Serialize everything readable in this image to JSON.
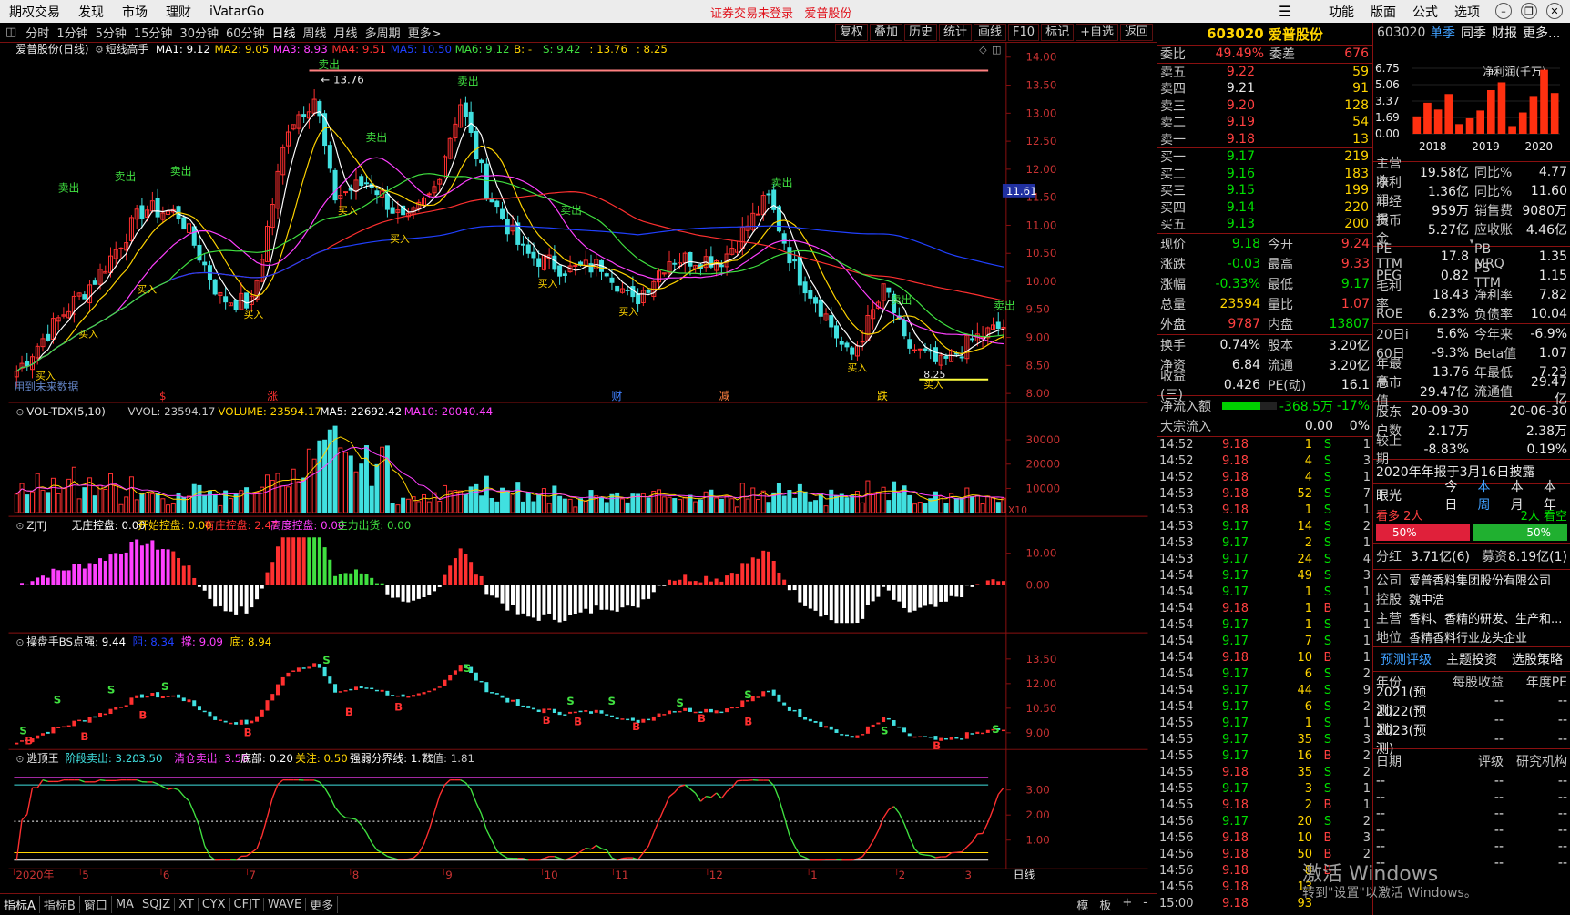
{
  "menu": [
    "期权交易",
    "发现",
    "市场",
    "理财",
    "iVatarGo"
  ],
  "notice": [
    "证券交易未登录",
    "爱普股份"
  ],
  "right_menu": [
    "功能",
    "版面",
    "公式",
    "选项"
  ],
  "timeframes": [
    "分时",
    "1分钟",
    "5分钟",
    "15分钟",
    "30分钟",
    "60分钟",
    "日线",
    "周线",
    "月线",
    "多周期",
    "更多>"
  ],
  "toolbar_right": [
    "复权",
    "叠加",
    "历史",
    "统计",
    "画线",
    "F10",
    "标记",
    "+自选",
    "返回"
  ],
  "main": {
    "title": "爱普股份(日线)",
    "indicator": "短线高手",
    "ma": [
      {
        "label": "MA1: 9.12",
        "color": "#ffffff"
      },
      {
        "label": "MA2: 9.05",
        "color": "#ffd400"
      },
      {
        "label": "MA3: 8.93",
        "color": "#ff40ff"
      },
      {
        "label": "MA4: 9.51",
        "color": "#ff3030"
      },
      {
        "label": "MA5: 10.50",
        "color": "#2040ff"
      },
      {
        "label": "MA6: 9.12",
        "color": "#40e040"
      },
      {
        "label": "B: -",
        "color": "#ffd400"
      },
      {
        "label": "S: 9.42",
        "color": "#40e040"
      },
      {
        "label": ": 13.76",
        "color": "#ffd400"
      },
      {
        "label": ": 8.25",
        "color": "#ffd400"
      }
    ],
    "yticks": [
      "14.00",
      "13.50",
      "13.00",
      "12.50",
      "12.00",
      "11.50",
      "11.00",
      "10.50",
      "10.00",
      "9.50",
      "9.00",
      "8.50",
      "8.00"
    ],
    "high_label": "13.76",
    "low_label": "8.25",
    "price_tag": "11.61",
    "note": "用到未来数据",
    "sell_label": "卖出",
    "buy_label": "买入",
    "events": [
      "$",
      "涨",
      "财",
      "减",
      "跌"
    ]
  },
  "vol": {
    "title": "VOL-TDX(5,10)",
    "items": [
      {
        "label": "VVOL: 23594.17",
        "color": "#c8c8c8"
      },
      {
        "label": "VOLUME: 23594.17",
        "color": "#ffd400"
      },
      {
        "label": "MA5: 22692.42",
        "color": "#ffffff"
      },
      {
        "label": "MA10: 20040.44",
        "color": "#ff40ff"
      }
    ],
    "yticks": [
      "30000",
      "20000",
      "10000"
    ],
    "unit": "X10"
  },
  "zjtj": {
    "title": "ZJTJ",
    "items": [
      {
        "label": "无庄控盘: 0.00",
        "color": "#ffffff"
      },
      {
        "label": "开始控盘: 0.00",
        "color": "#ffd400"
      },
      {
        "label": "有庄控盘: 2.47",
        "color": "#ff3030"
      },
      {
        "label": "高度控盘: 0.00",
        "color": "#ff40ff"
      },
      {
        "label": "主力出货: 0.00",
        "color": "#40e040"
      }
    ],
    "yticks": [
      "10.00",
      "0.00"
    ]
  },
  "bs": {
    "title": "操盘手BS点",
    "items": [
      {
        "label": "强: 9.44",
        "color": "#ffffff"
      },
      {
        "label": "阻: 8.34",
        "color": "#2040ff"
      },
      {
        "label": "撑: 9.09",
        "color": "#ff40ff"
      },
      {
        "label": "底: 8.94",
        "color": "#ffd400"
      }
    ],
    "yticks": [
      "13.50",
      "12.00",
      "10.50",
      "9.00"
    ]
  },
  "tdw": {
    "title": "逃顶王",
    "items": [
      {
        "label": "阶段卖出: 3.20",
        "color": "#40e0e0"
      },
      {
        "label": ": 3.50",
        "color": "#40e0e0"
      },
      {
        "label": "清仓卖出: 3.50",
        "color": "#ff40ff"
      },
      {
        "label": "底部: 0.20",
        "color": "#ffffff"
      },
      {
        "label": "关注: 0.50",
        "color": "#ffd400"
      },
      {
        "label": "强弱分界线: 1.75",
        "color": "#ffffff"
      },
      {
        "label": "数值: 1.81",
        "color": "#c8c8c8"
      }
    ],
    "yticks": [
      "3.00",
      "2.00",
      "1.00"
    ]
  },
  "xaxis": {
    "labels": [
      "2020年",
      "5",
      "6",
      "7",
      "8",
      "9",
      "10",
      "11",
      "12",
      "1",
      "2",
      "3"
    ],
    "mode": "日线"
  },
  "bottom_tabs": [
    "指标A",
    "指标B",
    "窗口",
    "MA",
    "SQJZ",
    "XT",
    "CYX",
    "CFJT",
    "WAVE",
    "更多"
  ],
  "bottom_right": [
    "模",
    "板",
    "+",
    "-"
  ],
  "quote": {
    "code": "603020",
    "name": "爱普股份",
    "weibi": {
      "k": "委比",
      "v": "49.49%",
      "k2": "委差",
      "v2": "676"
    },
    "asks": [
      {
        "label": "卖五",
        "price": "9.22",
        "vol": "59"
      },
      {
        "label": "卖四",
        "price": "9.21",
        "vol": "91"
      },
      {
        "label": "卖三",
        "price": "9.20",
        "vol": "128"
      },
      {
        "label": "卖二",
        "price": "9.19",
        "vol": "54"
      },
      {
        "label": "卖一",
        "price": "9.18",
        "vol": "13"
      }
    ],
    "bids": [
      {
        "label": "买一",
        "price": "9.17",
        "vol": "219"
      },
      {
        "label": "买二",
        "price": "9.16",
        "vol": "183"
      },
      {
        "label": "买三",
        "price": "9.15",
        "vol": "199"
      },
      {
        "label": "买四",
        "price": "9.14",
        "vol": "220"
      },
      {
        "label": "买五",
        "price": "9.13",
        "vol": "200"
      }
    ],
    "stats": [
      {
        "k": "现价",
        "v": "9.18",
        "vc": "dn",
        "k2": "今开",
        "v2": "9.24",
        "v2c": "up"
      },
      {
        "k": "涨跌",
        "v": "-0.03",
        "vc": "dn",
        "k2": "最高",
        "v2": "9.33",
        "v2c": "up"
      },
      {
        "k": "涨幅",
        "v": "-0.33%",
        "vc": "dn",
        "k2": "最低",
        "v2": "9.17",
        "v2c": "dn"
      },
      {
        "k": "总量",
        "v": "23594",
        "vc": "yl",
        "k2": "量比",
        "v2": "1.07",
        "v2c": "up"
      },
      {
        "k": "外盘",
        "v": "9787",
        "vc": "up",
        "k2": "内盘",
        "v2": "13807",
        "v2c": "dn"
      }
    ],
    "stats2": [
      {
        "k": "换手",
        "v": "0.74%",
        "k2": "股本",
        "v2": "3.20亿"
      },
      {
        "k": "净资",
        "v": "6.84",
        "k2": "流通",
        "v2": "3.20亿"
      },
      {
        "k": "收益(三)",
        "v": "0.426",
        "k2": "PE(动)",
        "v2": "16.1"
      }
    ],
    "flow": [
      {
        "k": "净流入额",
        "bar": 0.7,
        "v": "-368.5万",
        "v2": "-17%"
      },
      {
        "k": "大宗流入",
        "v": "0.00",
        "v2": "0%"
      }
    ],
    "ticks": [
      [
        "14:52",
        "9.18",
        "1",
        "S",
        "1"
      ],
      [
        "14:52",
        "9.18",
        "4",
        "S",
        "3"
      ],
      [
        "14:52",
        "9.18",
        "4",
        "S",
        "1"
      ],
      [
        "14:53",
        "9.18",
        "52",
        "S",
        "7"
      ],
      [
        "14:53",
        "9.18",
        "1",
        "S",
        "1"
      ],
      [
        "14:53",
        "9.17",
        "14",
        "S",
        "2"
      ],
      [
        "14:53",
        "9.17",
        "2",
        "S",
        "1"
      ],
      [
        "14:53",
        "9.17",
        "24",
        "S",
        "4"
      ],
      [
        "14:54",
        "9.17",
        "49",
        "S",
        "3"
      ],
      [
        "14:54",
        "9.17",
        "1",
        "S",
        "1"
      ],
      [
        "14:54",
        "9.18",
        "1",
        "B",
        "1"
      ],
      [
        "14:54",
        "9.17",
        "1",
        "S",
        "1"
      ],
      [
        "14:54",
        "9.17",
        "7",
        "S",
        "1"
      ],
      [
        "14:54",
        "9.18",
        "10",
        "B",
        "1"
      ],
      [
        "14:54",
        "9.17",
        "6",
        "S",
        "2"
      ],
      [
        "14:54",
        "9.17",
        "44",
        "S",
        "9"
      ],
      [
        "14:54",
        "9.17",
        "6",
        "S",
        "2"
      ],
      [
        "14:55",
        "9.17",
        "1",
        "S",
        "1"
      ],
      [
        "14:55",
        "9.17",
        "35",
        "S",
        "3"
      ],
      [
        "14:55",
        "9.17",
        "16",
        "B",
        "2"
      ],
      [
        "14:55",
        "9.18",
        "35",
        "S",
        "2"
      ],
      [
        "14:55",
        "9.17",
        "3",
        "S",
        "1"
      ],
      [
        "14:55",
        "9.18",
        "2",
        "B",
        "1"
      ],
      [
        "14:56",
        "9.17",
        "20",
        "S",
        "2"
      ],
      [
        "14:56",
        "9.18",
        "10",
        "B",
        "3"
      ],
      [
        "14:56",
        "9.18",
        "50",
        "B",
        "2"
      ],
      [
        "14:56",
        "9.18",
        "8",
        "B",
        ""
      ],
      [
        "14:56",
        "9.18",
        "13",
        "",
        ""
      ],
      [
        "15:00",
        "9.18",
        "93",
        "",
        ""
      ]
    ]
  },
  "info": {
    "code": "603020",
    "tabs": [
      "单季",
      "同季",
      "财报",
      "更多..."
    ],
    "chart_title": "净利润(千万)",
    "chart_data": {
      "type": "bar",
      "yticks": [
        "6.75",
        "5.06",
        "3.37",
        "1.69",
        "0.00"
      ],
      "years": [
        "2018",
        "2019",
        "2020"
      ],
      "values": [
        1.8,
        3.2,
        2.5,
        4.1,
        1.0,
        1.6,
        2.4,
        4.5,
        5.3,
        0.8,
        2.2,
        3.9,
        6.6,
        4.2
      ],
      "ylim": [
        0,
        6.75
      ]
    },
    "fin": [
      {
        "k": "主营收",
        "v": "19.58亿",
        "k2": "同比%",
        "v2": "4.77"
      },
      {
        "k": "净利润",
        "v": "1.36亿",
        "k2": "同比%",
        "v2": "11.60"
      },
      {
        "k": "非经损",
        "v": "959万",
        "k2": "销售费",
        "v2": "9080万"
      },
      {
        "k": "货币金",
        "v": "5.27亿",
        "k2": "应收账",
        "v2": "4.46亿"
      }
    ],
    "val": [
      {
        "k": "PE TTM",
        "v": "17.8",
        "k2": "PB MRQ",
        "v2": "1.35"
      },
      {
        "k": "PEG",
        "v": "0.82",
        "k2": "PS TTM",
        "v2": "1.15"
      },
      {
        "k": "毛利率",
        "v": "18.43",
        "k2": "净利率",
        "v2": "7.82"
      },
      {
        "k": "ROE",
        "v": "6.23%",
        "k2": "负债率",
        "v2": "10.04"
      }
    ],
    "perf": [
      {
        "k": "20日i",
        "v": "5.6%",
        "k2": "今年来",
        "v2": "-6.9%"
      },
      {
        "k": "60日",
        "v": "-9.3%",
        "k2": "Beta值",
        "v2": "1.07"
      },
      {
        "k": "年最高",
        "v": "13.76",
        "k2": "年最低",
        "v2": "7.23"
      },
      {
        "k": "总市值",
        "v": "29.47亿",
        "k2": "流通值",
        "v2": "29.47亿"
      }
    ],
    "holders": [
      {
        "k": "股东",
        "v": "20-09-30",
        "v2": "20-06-30"
      },
      {
        "k": "户数",
        "v": "2.17万",
        "v2": "2.38万"
      },
      {
        "k": "较上期",
        "v": "-8.83%",
        "v2": "0.19%"
      }
    ],
    "report_note": "2020年年报于3月16日披露",
    "vision": {
      "label": "眼光",
      "tabs": [
        "今日",
        "本周",
        "本月",
        "本年"
      ],
      "bull": "看多 2人",
      "bear": "2人 看空",
      "bull_pct": "50%",
      "bear_pct": "50%"
    },
    "dividend": {
      "k": "分红",
      "v": "3.71亿(6)",
      "k2": "募资",
      "v2": "8.19亿(1)"
    },
    "company": [
      {
        "k": "公司",
        "v": "爱普香料集团股份有限公司"
      },
      {
        "k": "控股",
        "v": "魏中浩"
      },
      {
        "k": "主营",
        "v": "香料、香精的研发、生产和..."
      },
      {
        "k": "地位",
        "v": "香精香料行业龙头企业"
      }
    ],
    "fc_tabs": [
      "预测评级",
      "主题投资",
      "选股策略"
    ],
    "fc_head": [
      "年份",
      "每股收益",
      "年度PE"
    ],
    "fc_rows": [
      [
        "2021(预测)",
        "--",
        "--"
      ],
      [
        "2022(预测)",
        "--",
        "--"
      ],
      [
        "2023(预测)",
        "--",
        "--"
      ]
    ],
    "rating_head": [
      "日期",
      "评级",
      "研究机构"
    ],
    "rating_rows": [
      [
        "--",
        "--",
        "--"
      ],
      [
        "--",
        "--",
        "--"
      ],
      [
        "--",
        "--",
        "--"
      ],
      [
        "--",
        "--",
        "--"
      ],
      [
        "--",
        "--",
        "--"
      ],
      [
        "--",
        "--",
        "--"
      ]
    ]
  },
  "watermark": [
    "激活 Windows",
    "转到\"设置\"以激活 Windows。"
  ]
}
